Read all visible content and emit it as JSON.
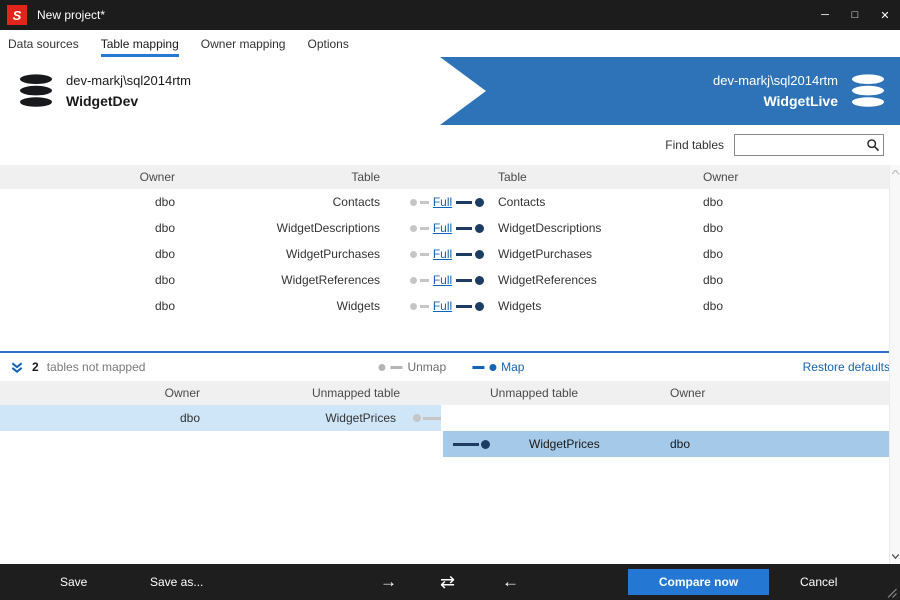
{
  "window": {
    "title": "New project*",
    "logo_letter": "S",
    "controls": {
      "minimize_glyph": "─",
      "maximize_glyph": "□",
      "close_glyph": "✕"
    }
  },
  "tabs": [
    {
      "label": "Data sources",
      "active": false
    },
    {
      "label": "Table mapping",
      "active": true
    },
    {
      "label": "Owner mapping",
      "active": false
    },
    {
      "label": "Options",
      "active": false
    }
  ],
  "sources": {
    "left": {
      "server": "dev-markj\\sql2014rtm",
      "database": "WidgetDev"
    },
    "right": {
      "server": "dev-markj\\sql2014rtm",
      "database": "WidgetLive"
    }
  },
  "search": {
    "label": "Find tables",
    "value": ""
  },
  "mapped": {
    "headers": {
      "owner_left": "Owner",
      "table_left": "Table",
      "table_right": "Table",
      "owner_right": "Owner"
    },
    "rows": [
      {
        "owner_left": "dbo",
        "table_left": "Contacts",
        "mapping": "Full",
        "table_right": "Contacts",
        "owner_right": "dbo"
      },
      {
        "owner_left": "dbo",
        "table_left": "WidgetDescriptions",
        "mapping": "Full",
        "table_right": "WidgetDescriptions",
        "owner_right": "dbo"
      },
      {
        "owner_left": "dbo",
        "table_left": "WidgetPurchases",
        "mapping": "Full",
        "table_right": "WidgetPurchases",
        "owner_right": "dbo"
      },
      {
        "owner_left": "dbo",
        "table_left": "WidgetReferences",
        "mapping": "Full",
        "table_right": "WidgetReferences",
        "owner_right": "dbo"
      },
      {
        "owner_left": "dbo",
        "table_left": "Widgets",
        "mapping": "Full",
        "table_right": "Widgets",
        "owner_right": "dbo"
      }
    ]
  },
  "unmap_bar": {
    "count": "2",
    "label": "tables not mapped",
    "unmap_label": "Unmap",
    "map_label": "Map",
    "restore_label": "Restore defaults"
  },
  "unmapped": {
    "headers": {
      "owner_left": "Owner",
      "table_left": "Unmapped table",
      "table_right": "Unmapped table",
      "owner_right": "Owner"
    },
    "left_row": {
      "owner": "dbo",
      "table": "WidgetPrices"
    },
    "right_row": {
      "table": "WidgetPrices",
      "owner": "dbo"
    }
  },
  "footer": {
    "save_label": "Save",
    "save_as_label": "Save as...",
    "arrow_right_glyph": "→",
    "swap_glyph": "⇄",
    "arrow_left_glyph": "←",
    "compare_label": "Compare now",
    "cancel_label": "Cancel"
  },
  "colors": {
    "titlebar": "#1c1c1c",
    "logo_red": "#e1251b",
    "accent_blue": "#2b72c8",
    "arrow_banner_blue": "#2e73b8",
    "link_blue": "#1464b4",
    "toggle_dark_blue": "#1d3c63",
    "row_highlight_left": "#cfe6f8",
    "row_selected_right": "#a5c9e8",
    "compare_button_blue": "#2478d4"
  }
}
